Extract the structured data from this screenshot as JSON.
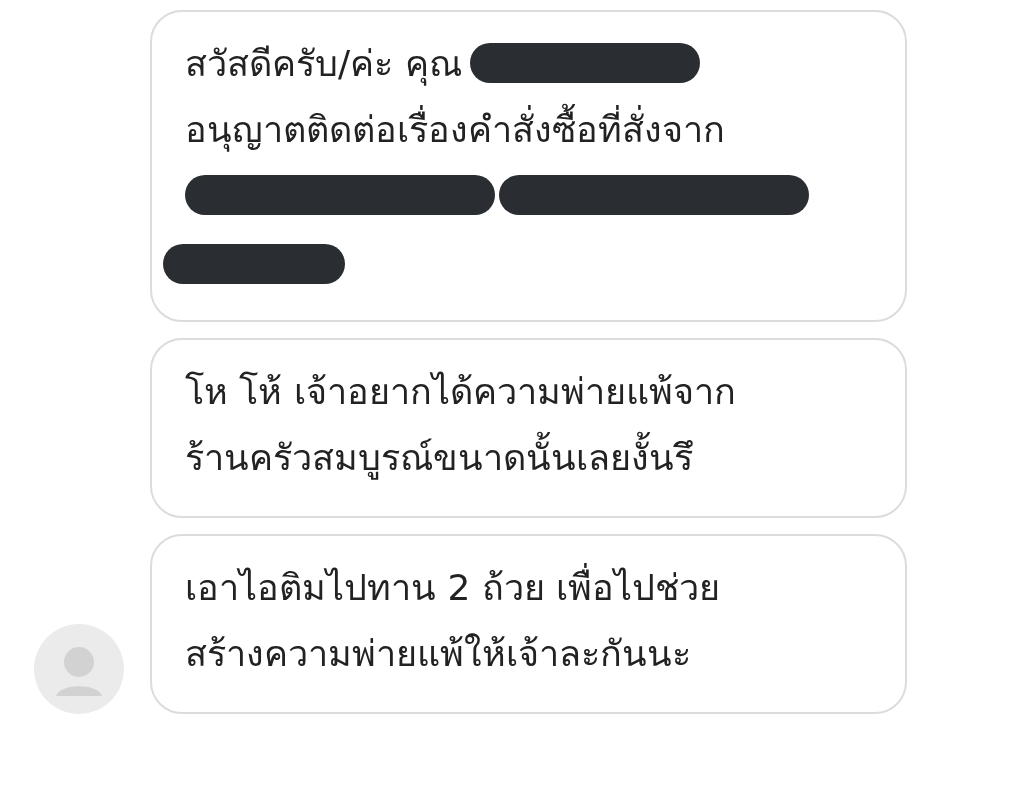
{
  "messages": [
    {
      "avatar": false,
      "lines": [
        [
          {
            "kind": "text",
            "text": "สวัสดีครับ/ค่ะ คุณ"
          },
          {
            "kind": "redaction"
          }
        ],
        [
          {
            "kind": "text",
            "text": "อนุญาตติดต่อเรื่องคำสั่งซื้อที่สั่งจาก"
          }
        ],
        [
          {
            "kind": "redaction"
          },
          {
            "kind": "redaction"
          }
        ],
        [
          {
            "kind": "redaction"
          }
        ]
      ]
    },
    {
      "avatar": false,
      "lines": [
        [
          {
            "kind": "text",
            "text": "โห โห้ เจ้าอยากได้ความพ่ายแพ้จาก"
          }
        ],
        [
          {
            "kind": "text",
            "text": "ร้านครัวสมบูรณ์ขนาดนั้นเลยงั้นรึ"
          }
        ]
      ]
    },
    {
      "avatar": true,
      "lines": [
        [
          {
            "kind": "text",
            "text": "เอาไอติมไปทาน 2 ถ้วย เพื่อไปช่วย"
          }
        ],
        [
          {
            "kind": "text",
            "text": "สร้างความพ่ายแพ้ให้เจ้าละกันนะ"
          }
        ]
      ]
    }
  ]
}
